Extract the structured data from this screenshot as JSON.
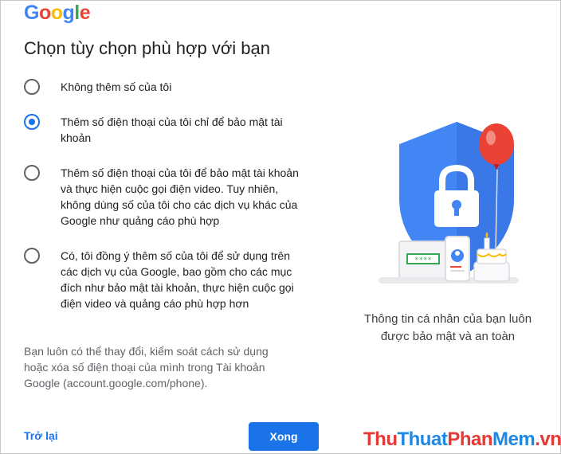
{
  "logo": {
    "letters": [
      {
        "ch": "G",
        "color": "#4285F4"
      },
      {
        "ch": "o",
        "color": "#EA4335"
      },
      {
        "ch": "o",
        "color": "#FBBC05"
      },
      {
        "ch": "g",
        "color": "#4285F4"
      },
      {
        "ch": "l",
        "color": "#34A853"
      },
      {
        "ch": "e",
        "color": "#EA4335"
      }
    ]
  },
  "title": "Chọn tùy chọn phù hợp với bạn",
  "options": [
    {
      "label": "Không thêm số của tôi",
      "selected": false
    },
    {
      "label": "Thêm số điện thoại của tôi chỉ để bảo mật tài khoản",
      "selected": true
    },
    {
      "label": "Thêm số điện thoại của tôi để bảo mật tài khoản và thực hiện cuộc gọi điện video. Tuy nhiên, không dùng số của tôi cho các dịch vụ khác của Google như quảng cáo phù hợp",
      "selected": false
    },
    {
      "label": "Có, tôi đồng ý thêm số của tôi để sử dụng trên các dịch vụ của Google, bao gồm cho các mục đích như bảo mật tài khoản, thực hiện cuộc gọi điện video và quảng cáo phù hợp hơn",
      "selected": false
    }
  ],
  "note": "Bạn luôn có thể thay đổi, kiểm soát cách sử dụng hoặc xóa số điện thoại của mình trong Tài khoản Google (account.google.com/phone).",
  "back_label": "Trở lại",
  "done_label": "Xong",
  "illustration": {
    "password_mask": "****",
    "caption": "Thông tin cá nhân của bạn luôn được bảo mật và an toàn"
  },
  "watermark": {
    "parts": [
      "Thu",
      "Thuat",
      "Phan",
      "Mem",
      ".vn"
    ]
  },
  "colors": {
    "accent": "#1a73e8",
    "shield": "#4285F4",
    "balloon": "#EA4335"
  }
}
